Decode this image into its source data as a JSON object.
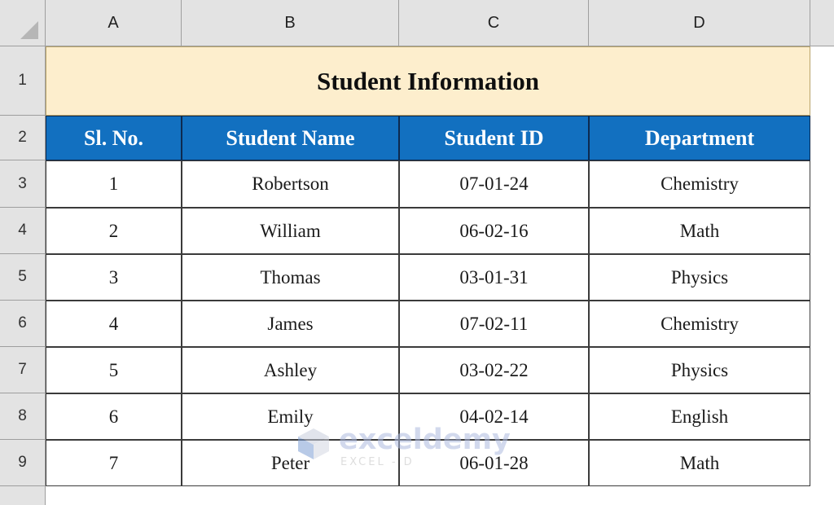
{
  "app": {
    "type": "spreadsheet",
    "select_all_icon": "select-all-triangle-icon"
  },
  "grid": {
    "column_headers": [
      "A",
      "B",
      "C",
      "D"
    ],
    "row_headers": [
      "1",
      "2",
      "3",
      "4",
      "5",
      "6",
      "7",
      "8",
      "9"
    ]
  },
  "sheet": {
    "title": "Student Information",
    "title_merged_range": "A1:D1",
    "title_bg": "#fdeecd",
    "header_bg": "#1270c0",
    "header_fg": "#ffffff",
    "columns": [
      "Sl. No.",
      "Student Name",
      "Student ID",
      "Department"
    ],
    "rows": [
      {
        "sl_no": "1",
        "student_name": "Robertson",
        "student_id": "07-01-24",
        "department": "Chemistry"
      },
      {
        "sl_no": "2",
        "student_name": "William",
        "student_id": "06-02-16",
        "department": "Math"
      },
      {
        "sl_no": "3",
        "student_name": "Thomas",
        "student_id": "03-01-31",
        "department": "Physics"
      },
      {
        "sl_no": "4",
        "student_name": "James",
        "student_id": "07-02-11",
        "department": "Chemistry"
      },
      {
        "sl_no": "5",
        "student_name": "Ashley",
        "student_id": "03-02-22",
        "department": "Physics"
      },
      {
        "sl_no": "6",
        "student_name": "Emily",
        "student_id": "04-02-14",
        "department": "English"
      },
      {
        "sl_no": "7",
        "student_name": "Peter",
        "student_id": "06-01-28",
        "department": "Math"
      }
    ]
  },
  "watermark": {
    "word": "exceldemy",
    "subtitle": "EXCEL - D",
    "logo_icon": "exceldemy-cube-logo-icon"
  }
}
